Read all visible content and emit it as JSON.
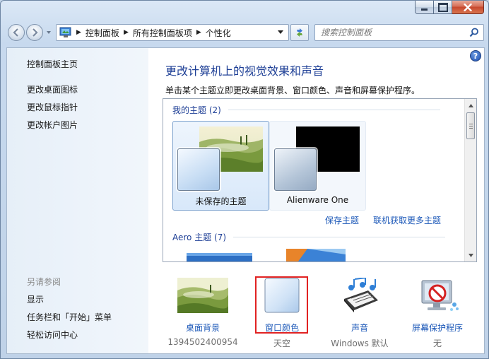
{
  "address": {
    "crumbs": [
      "控制面板",
      "所有控制面板项",
      "个性化"
    ]
  },
  "search": {
    "placeholder": "搜索控制面板"
  },
  "left": {
    "home": "控制面板主页",
    "links": [
      "更改桌面图标",
      "更改鼠标指针",
      "更改帐户图片"
    ],
    "see_also": "另请参阅",
    "see_links": [
      "显示",
      "任务栏和「开始」菜单",
      "轻松访问中心"
    ]
  },
  "main": {
    "title": "更改计算机上的视觉效果和声音",
    "subtitle": "单击某个主题立即更改桌面背景、窗口颜色、声音和屏幕保护程序。",
    "my_themes_header": "我的主题 (2)",
    "themes": [
      {
        "label": "未保存的主题"
      },
      {
        "label": "Alienware One"
      }
    ],
    "save_theme": "保存主题",
    "get_more": "联机获取更多主题",
    "aero_header": "Aero 主题 (7)"
  },
  "bottom": {
    "items": [
      {
        "label": "桌面背景",
        "sub": "1394502400954"
      },
      {
        "label": "窗口颜色",
        "sub": "天空"
      },
      {
        "label": "声音",
        "sub": "Windows 默认"
      },
      {
        "label": "屏幕保护程序",
        "sub": "无"
      }
    ]
  },
  "colors": {
    "link": "#1c58b8",
    "title": "#1e3f96",
    "highlight": "#e12222"
  }
}
